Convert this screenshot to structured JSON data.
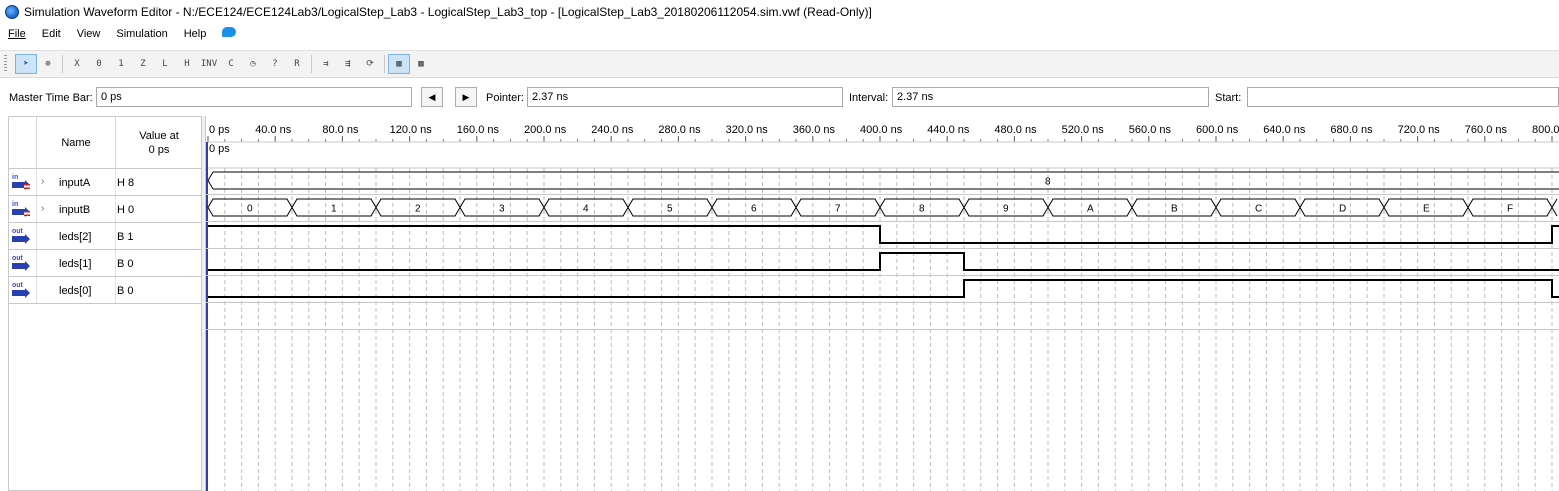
{
  "window": {
    "title": "Simulation Waveform Editor - N:/ECE124/ECE124Lab3/LogicalStep_Lab3 - LogicalStep_Lab3_top - [LogicalStep_Lab3_20180206112054.sim.vwf (Read-Only)]"
  },
  "menu": [
    "File",
    "Edit",
    "View",
    "Simulation",
    "Help"
  ],
  "toolbar": {
    "buttons": [
      {
        "name": "selection-tool-icon",
        "glyph": "➤"
      },
      {
        "name": "zoom-tool-icon",
        "glyph": "⊕"
      },
      {
        "name": "unknown-value-icon",
        "glyph": "X"
      },
      {
        "name": "forcing-low-icon",
        "glyph": "0"
      },
      {
        "name": "forcing-high-icon",
        "glyph": "1"
      },
      {
        "name": "high-impedance-icon",
        "glyph": "Z"
      },
      {
        "name": "weak-low-icon",
        "glyph": "L"
      },
      {
        "name": "weak-high-icon",
        "glyph": "H"
      },
      {
        "name": "invert-icon",
        "glyph": "INV"
      },
      {
        "name": "count-value-icon",
        "glyph": "C"
      },
      {
        "name": "clock-value-icon",
        "glyph": "◷"
      },
      {
        "name": "arbitrary-value-icon",
        "glyph": "?"
      },
      {
        "name": "random-value-icon",
        "glyph": "R"
      },
      {
        "name": "run-functional-simulation-icon",
        "glyph": "⇉"
      },
      {
        "name": "run-timing-simulation-icon",
        "glyph": "⇶"
      },
      {
        "name": "generate-netlist-icon",
        "glyph": "⟳"
      },
      {
        "name": "snap-to-grid-icon",
        "glyph": "▦"
      },
      {
        "name": "grid-settings-icon",
        "glyph": "▩"
      }
    ]
  },
  "timebar": {
    "master_label": "Master Time Bar:",
    "master_value": "0 ps",
    "pointer_label": "Pointer:",
    "pointer_value": "2.37 ns",
    "interval_label": "Interval:",
    "interval_value": "2.37 ns",
    "start_label": "Start:",
    "start_value": ""
  },
  "signal_list": {
    "header_name": "Name",
    "header_value_line1": "Value at",
    "header_value_line2": "0 ps",
    "signals": [
      {
        "icon": "in",
        "expandable": true,
        "name": "inputA",
        "value": "H 8"
      },
      {
        "icon": "in",
        "expandable": true,
        "name": "inputB",
        "value": "H 0"
      },
      {
        "icon": "out",
        "expandable": false,
        "name": "leds[2]",
        "value": "B 1"
      },
      {
        "icon": "out",
        "expandable": false,
        "name": "leds[1]",
        "value": "B 0"
      },
      {
        "icon": "out",
        "expandable": false,
        "name": "leds[0]",
        "value": "B 0"
      }
    ]
  },
  "waveform": {
    "time_unit": "ns",
    "time_labels": [
      "0 ps",
      "40.0 ns",
      "80.0 ns",
      "120.0 ns",
      "160.0 ns",
      "200.0 ns",
      "240.0 ns",
      "280.0 ns",
      "320.0 ns",
      "360.0 ns",
      "400.0 ns",
      "440.0 ns",
      "480.0 ns",
      "520.0 ns",
      "560.0 ns",
      "600.0 ns",
      "640.0 ns",
      "680.0 ns",
      "720.0 ns",
      "760.0 ns",
      "800.0 ns"
    ],
    "cursor_label": "0 ps",
    "inputA_value": "8",
    "inputB_segments": [
      "0",
      "1",
      "2",
      "3",
      "4",
      "5",
      "6",
      "7",
      "8",
      "9",
      "A",
      "B",
      "C",
      "D",
      "E",
      "F"
    ],
    "segment_length_ns": 50,
    "leds2": {
      "high_until_ns": 400,
      "high_again_from_ns": 800
    },
    "leds1": {
      "high_from_ns": 400,
      "high_until_ns": 450
    },
    "leds0": {
      "high_from_ns": 450,
      "high_until_ns": 800
    }
  }
}
